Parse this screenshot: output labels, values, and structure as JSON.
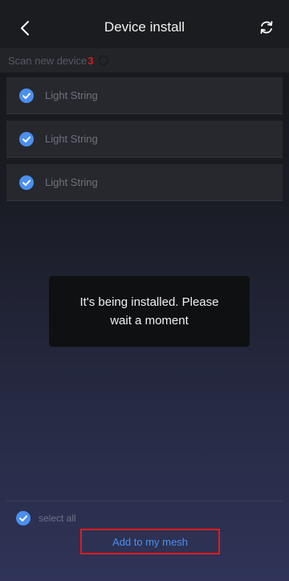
{
  "header": {
    "title": "Device install",
    "back_icon": "chevron-left-icon",
    "refresh_icon": "refresh-icon"
  },
  "scan": {
    "label": "Scan new device",
    "count": "3",
    "spinner_icon": "loading-spinner-icon"
  },
  "devices": [
    {
      "label": "Light String",
      "checked": true
    },
    {
      "label": "Light String",
      "checked": true
    },
    {
      "label": "Light String",
      "checked": true
    }
  ],
  "toast": {
    "message": "It's being installed. Please wait a moment"
  },
  "footer": {
    "select_all_label": "select all",
    "select_all_checked": true,
    "add_button_label": "Add to my mesh"
  },
  "colors": {
    "accent_blue": "#4b8ff0",
    "count_red": "#d01e1e",
    "highlight_red": "#e21b1b"
  }
}
